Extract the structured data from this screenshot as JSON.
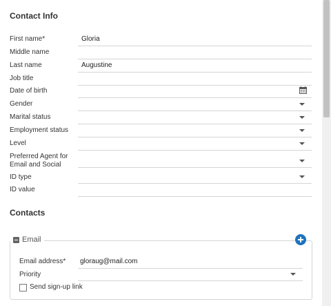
{
  "contact_info": {
    "title": "Contact Info",
    "fields": [
      {
        "label": "First name*",
        "value": "Gloria",
        "control": "text"
      },
      {
        "label": "Middle name",
        "value": "",
        "control": "text"
      },
      {
        "label": "Last name",
        "value": "Augustine",
        "control": "text"
      },
      {
        "label": "Job title",
        "value": "",
        "control": "text"
      },
      {
        "label": "Date of birth",
        "value": "",
        "control": "date"
      },
      {
        "label": "Gender",
        "value": "",
        "control": "dropdown"
      },
      {
        "label": "Marital status",
        "value": "",
        "control": "dropdown"
      },
      {
        "label": "Employment status",
        "value": "",
        "control": "dropdown"
      },
      {
        "label": "Level",
        "value": "",
        "control": "dropdown"
      },
      {
        "label": "Preferred Agent for Email and Social",
        "value": "",
        "control": "dropdown"
      },
      {
        "label": "ID type",
        "value": "",
        "control": "dropdown"
      },
      {
        "label": "ID value",
        "value": "",
        "control": "text"
      }
    ]
  },
  "contacts": {
    "title": "Contacts",
    "email_group": {
      "legend": "Email",
      "email_address_label": "Email address*",
      "email_address_value": "gloraug@mail.com",
      "priority_label": "Priority",
      "priority_value": "",
      "send_signup_label": "Send sign-up link",
      "send_signup_checked": false
    }
  },
  "colors": {
    "accent": "#1e73be",
    "border": "#d5d5d5"
  },
  "icons": {
    "date": "calendar-icon",
    "dropdown": "chevron-down-icon",
    "add": "add-circle-icon",
    "collapse": "minus-square-icon"
  }
}
